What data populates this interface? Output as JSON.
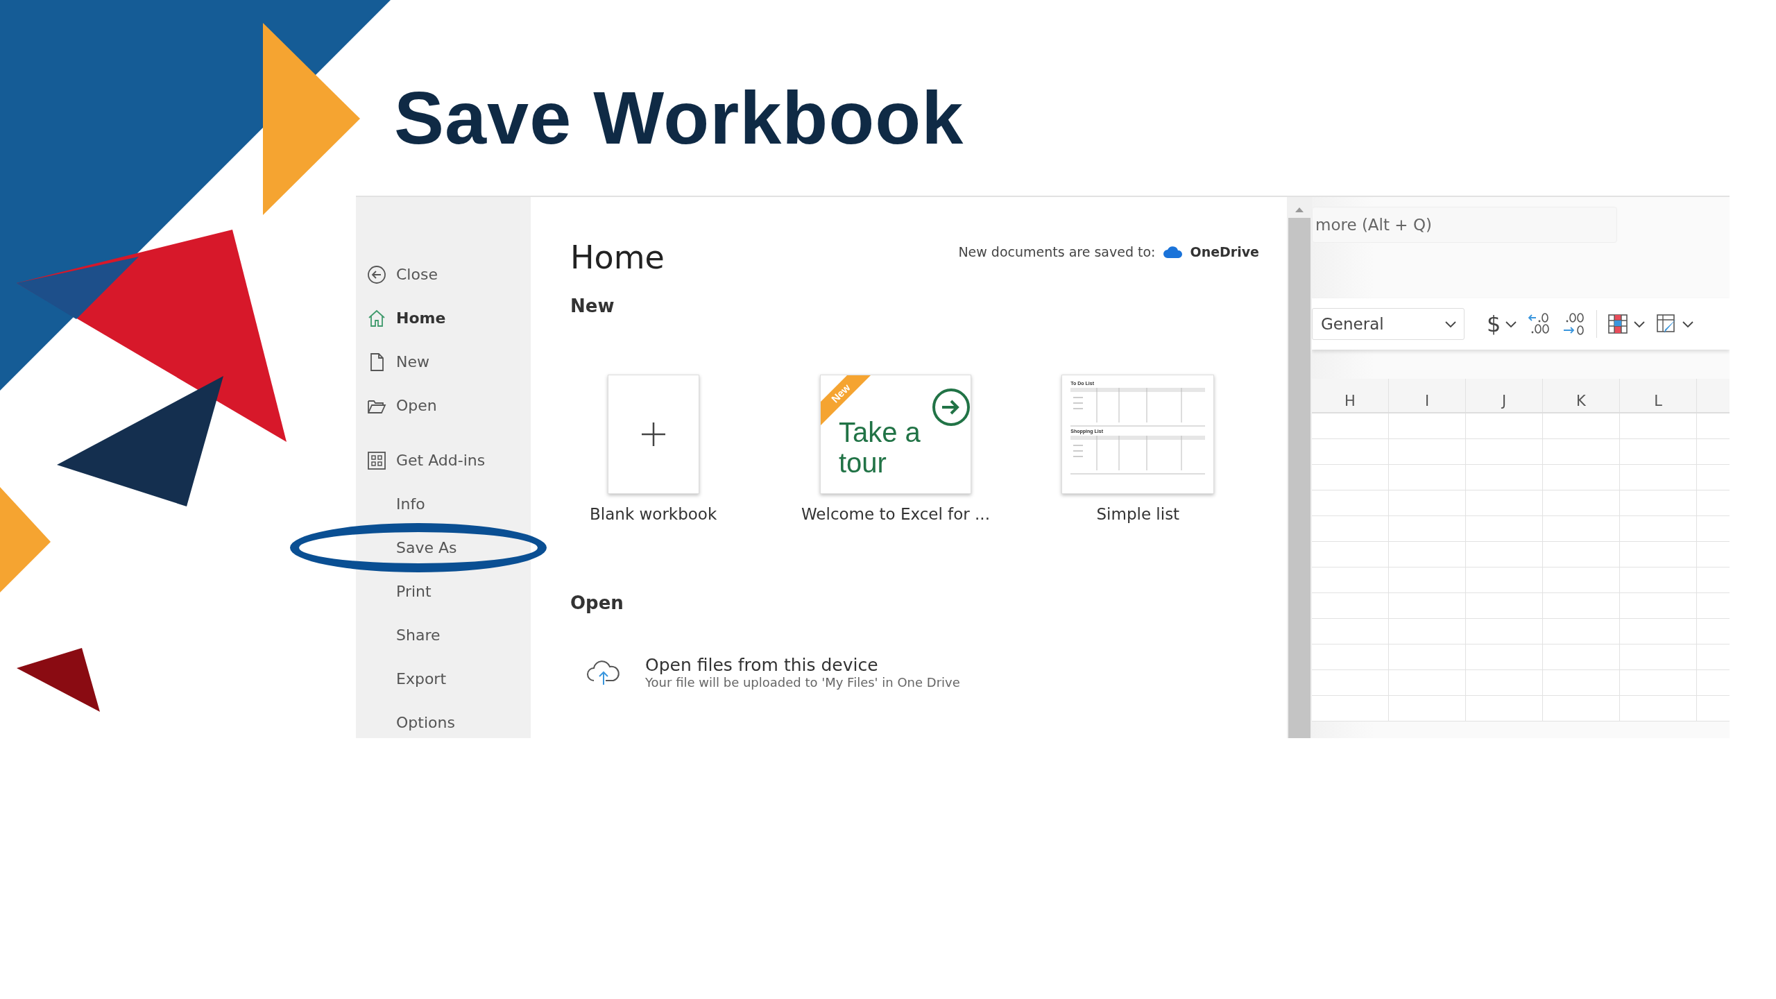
{
  "slide": {
    "title": "Save Workbook"
  },
  "backstage": {
    "sidebar": {
      "sections": [
        [
          {
            "label": "Close",
            "selected": false,
            "circled": false
          },
          {
            "label": "Home",
            "selected": true,
            "circled": false
          },
          {
            "label": "New",
            "selected": false,
            "circled": false
          },
          {
            "label": "Open",
            "selected": false,
            "circled": false
          }
        ],
        [
          {
            "label": "Get Add-ins",
            "selected": false,
            "circled": false
          },
          {
            "label": "Info",
            "selected": false,
            "circled": false
          },
          {
            "label": "Save As",
            "selected": false,
            "circled": true
          },
          {
            "label": "Print",
            "selected": false,
            "circled": false
          },
          {
            "label": "Share",
            "selected": false,
            "circled": false
          },
          {
            "label": "Export",
            "selected": false,
            "circled": false
          },
          {
            "label": "Options",
            "selected": false,
            "circled": false
          }
        ]
      ]
    },
    "heading": "Home",
    "save_location": {
      "label": "New documents are saved to:",
      "service": "OneDrive"
    },
    "new_section": {
      "title": "New",
      "templates": [
        {
          "kind": "blank",
          "caption": "Blank workbook"
        },
        {
          "kind": "tour",
          "caption": "Welcome to Excel for ...",
          "badge": "New",
          "text": "Take a tour"
        },
        {
          "kind": "list",
          "caption": "Simple list",
          "headings": [
            "To Do List",
            "Shopping List"
          ]
        }
      ]
    },
    "open_section": {
      "title": "Open",
      "items": [
        {
          "title": "Open files from this device",
          "subtitle": "Your file will be uploaded to 'My Files' in One Drive"
        }
      ]
    }
  },
  "excel": {
    "search": {
      "placeholder": "more (Alt + Q)"
    },
    "number_format": "General",
    "currency_symbol": "$",
    "columns": [
      "H",
      "I",
      "J",
      "K",
      "L"
    ]
  }
}
